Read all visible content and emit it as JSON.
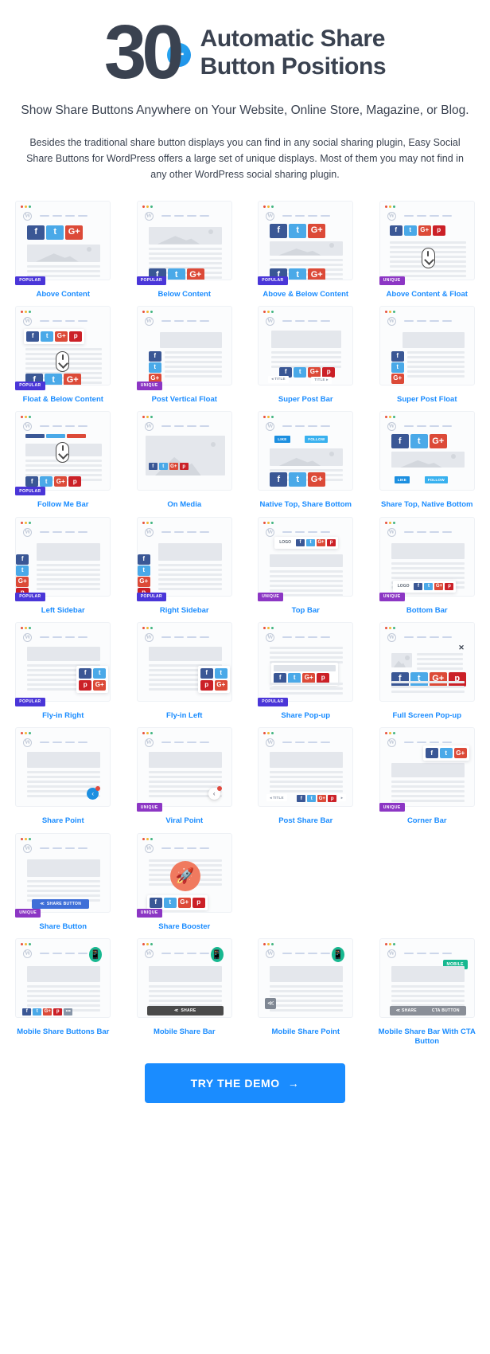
{
  "hero": {
    "number": "30",
    "plus": "+",
    "title_line1": "Automatic Share",
    "title_line2": "Button Positions",
    "subtitle": "Show Share Buttons Anywhere on Your Website, Online Store, Magazine, or Blog.",
    "body": "Besides the traditional share button displays you can find in any social sharing plugin, Easy Social Share Buttons for WordPress offers a large set of unique displays. Most of them you may not find in any other WordPress social sharing plugin."
  },
  "colors": {
    "accent_blue": "#1a8cff",
    "badge_popular": "#4a36d8",
    "badge_unique": "#8c36c4",
    "badge_mobile": "#17b890",
    "facebook": "#3a5795",
    "twitter": "#4aa9e8",
    "googleplus": "#dc4a38",
    "pinterest": "#cb2027",
    "headline": "#3a4250"
  },
  "labels": {
    "popular": "POPULAR",
    "unique": "UNIQUE",
    "mobile": "MOBILE",
    "share_button": "SHARE BUTTON",
    "share": "SHARE",
    "cta_button": "CTA BUTTON",
    "like": "LIKE",
    "follow": "FOLLOW",
    "title": "TITLE",
    "logo": "LOGO",
    "fb": "f",
    "tw": "t",
    "gp": "G+",
    "pi": "p",
    "more": "•••"
  },
  "cards": [
    {
      "name": "Above Content",
      "badge": "POPULAR"
    },
    {
      "name": "Below Content",
      "badge": "POPULAR"
    },
    {
      "name": "Above & Below Content",
      "badge": "POPULAR"
    },
    {
      "name": "Above Content & Float",
      "badge": "UNIQUE"
    },
    {
      "name": "Float & Below Content",
      "badge": "POPULAR"
    },
    {
      "name": "Post Vertical Float",
      "badge": "UNIQUE"
    },
    {
      "name": "Super Post Bar",
      "badge": ""
    },
    {
      "name": "Super Post Float",
      "badge": ""
    },
    {
      "name": "Follow Me Bar",
      "badge": "POPULAR"
    },
    {
      "name": "On Media",
      "badge": ""
    },
    {
      "name": "Native Top, Share Bottom",
      "badge": ""
    },
    {
      "name": "Share Top, Native Bottom",
      "badge": ""
    },
    {
      "name": "Left Sidebar",
      "badge": "POPULAR"
    },
    {
      "name": "Right Sidebar",
      "badge": "POPULAR"
    },
    {
      "name": "Top Bar",
      "badge": "UNIQUE"
    },
    {
      "name": "Bottom Bar",
      "badge": "UNIQUE"
    },
    {
      "name": "Fly-in Right",
      "badge": "POPULAR"
    },
    {
      "name": "Fly-in Left",
      "badge": ""
    },
    {
      "name": "Share Pop-up",
      "badge": "POPULAR"
    },
    {
      "name": "Full Screen Pop-up",
      "badge": ""
    },
    {
      "name": "Share Point",
      "badge": ""
    },
    {
      "name": "Viral Point",
      "badge": "UNIQUE"
    },
    {
      "name": "Post Share Bar",
      "badge": ""
    },
    {
      "name": "Corner Bar",
      "badge": "UNIQUE"
    },
    {
      "name": "Share Button",
      "badge": "UNIQUE"
    },
    {
      "name": "Share Booster",
      "badge": "UNIQUE"
    },
    {
      "name": "",
      "badge": ""
    },
    {
      "name": "",
      "badge": ""
    },
    {
      "name": "Mobile Share Buttons Bar",
      "badge": ""
    },
    {
      "name": "Mobile Share Bar",
      "badge": ""
    },
    {
      "name": "Mobile Share Point",
      "badge": ""
    },
    {
      "name": "Mobile Share Bar With CTA Button",
      "badge": ""
    }
  ],
  "cta": {
    "label": "TRY THE DEMO",
    "arrow": "→"
  }
}
